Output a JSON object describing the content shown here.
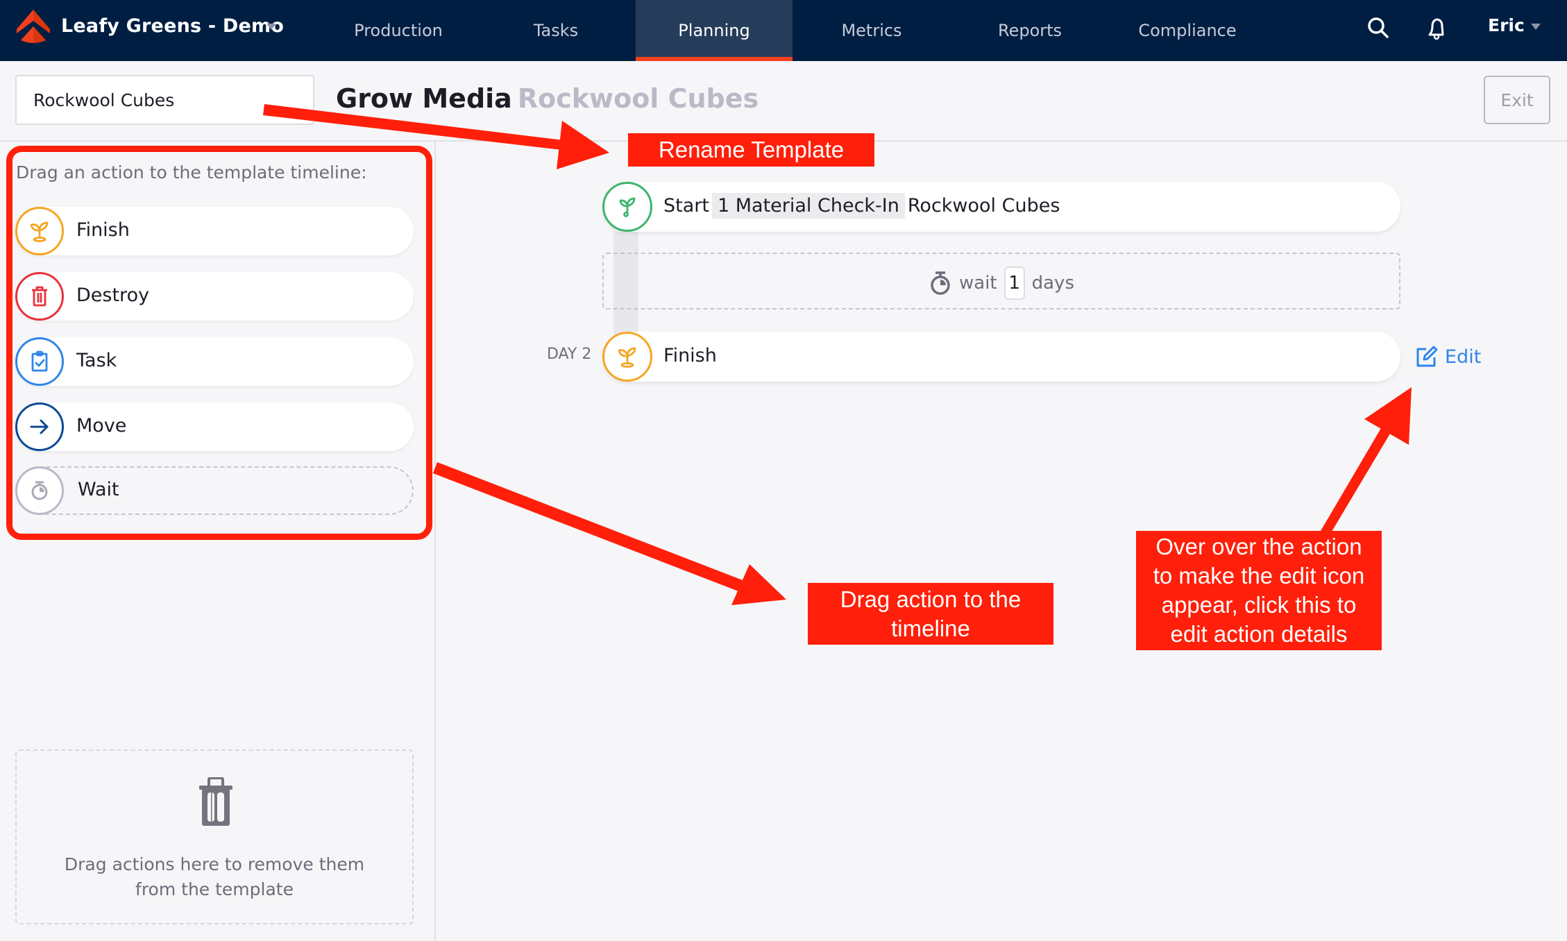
{
  "nav": {
    "org_name": "Leafy Greens - Demo",
    "tabs": [
      {
        "label": "Production",
        "active": false
      },
      {
        "label": "Tasks",
        "active": false
      },
      {
        "label": "Planning",
        "active": true
      },
      {
        "label": "Metrics",
        "active": false
      },
      {
        "label": "Reports",
        "active": false
      },
      {
        "label": "Compliance",
        "active": false
      }
    ],
    "user": "Eric",
    "icons": {
      "search": "search-icon",
      "notifications": "bell-icon"
    }
  },
  "header": {
    "template_name_value": "Rockwool Cubes",
    "title_main": "Grow Media",
    "title_sub": "Rockwool Cubes",
    "exit_label": "Exit"
  },
  "sidebar": {
    "hint": "Drag an action to the template timeline:",
    "actions": [
      {
        "label": "Finish",
        "icon": "sprout-icon",
        "color": "#f5a623"
      },
      {
        "label": "Destroy",
        "icon": "trash-icon",
        "color": "#e8323c"
      },
      {
        "label": "Task",
        "icon": "clipboard-check-icon",
        "color": "#2f86e8"
      },
      {
        "label": "Move",
        "icon": "arrow-right-icon",
        "color": "#0c4a94"
      },
      {
        "label": "Wait",
        "icon": "stopwatch-icon",
        "color": "#b8b9c6"
      }
    ],
    "trash_zone_text_line1": "Drag actions here to remove them",
    "trash_zone_text_line2": "from the template"
  },
  "timeline": {
    "start": {
      "verb": "Start",
      "chip": "1 Material Check-In",
      "item": "Rockwool Cubes",
      "color": "#3cb46e"
    },
    "wait": {
      "word": "wait",
      "value": "1",
      "unit": "days"
    },
    "finish": {
      "day_label": "DAY 2",
      "label": "Finish",
      "color": "#f5a623"
    },
    "edit_label": "Edit"
  },
  "annotations": {
    "rename": "Rename Template",
    "drag_line1": "Drag action to the",
    "drag_line2": "timeline",
    "edit_line1": "Over over the action",
    "edit_line2": "to make the edit icon",
    "edit_line3": "appear, click this to",
    "edit_line4": "edit action details"
  },
  "colors": {
    "nav_bg": "#001e42",
    "active_tab_bg": "#253d5a",
    "active_tab_accent": "#f2401e",
    "annotation_red": "#ff1f0a",
    "link_blue": "#2f86e8"
  }
}
